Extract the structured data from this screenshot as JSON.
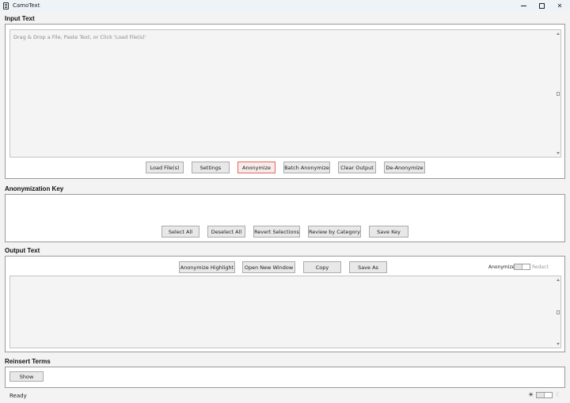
{
  "window": {
    "title": "CamoText",
    "minimize_icon": "minimize-icon",
    "maximize_icon": "maximize-icon",
    "close_symbol": "✕"
  },
  "input_section": {
    "title": "Input Text",
    "placeholder": "Drag & Drop a File, Paste Text, or Click 'Load File(s)'",
    "buttons": {
      "load_files": "Load File(s)",
      "settings": "Settings",
      "anonymize": "Anonymize",
      "batch_anonymize": "Batch Anonymize",
      "clear_output": "Clear Output",
      "de_anonymize": "De-Anonymize"
    }
  },
  "key_section": {
    "title": "Anonymization Key",
    "buttons": {
      "select_all": "Select All",
      "deselect_all": "Deselect All",
      "revert_selections": "Revert Selections",
      "review_by_category": "Review by Category",
      "save_key": "Save Key"
    }
  },
  "output_section": {
    "title": "Output Text",
    "buttons": {
      "anonymize_highlight": "Anonymize Highlight",
      "open_new_window": "Open New Window",
      "copy": "Copy",
      "save_as": "Save As"
    },
    "mode_toggle": {
      "left_label": "Anonymize",
      "right_label": "Redact",
      "state": "Anonymize"
    }
  },
  "reinsert_section": {
    "title": "Reinsert Terms",
    "show_label": "Show"
  },
  "status_bar": {
    "status": "Ready",
    "theme_light_symbol": "☀",
    "theme_dark_symbol": "☾",
    "theme_state": "light"
  },
  "colors": {
    "accent_red": "#e06a5a",
    "titlebar": "#eef3f8",
    "panel_bg": "#ffffff"
  }
}
